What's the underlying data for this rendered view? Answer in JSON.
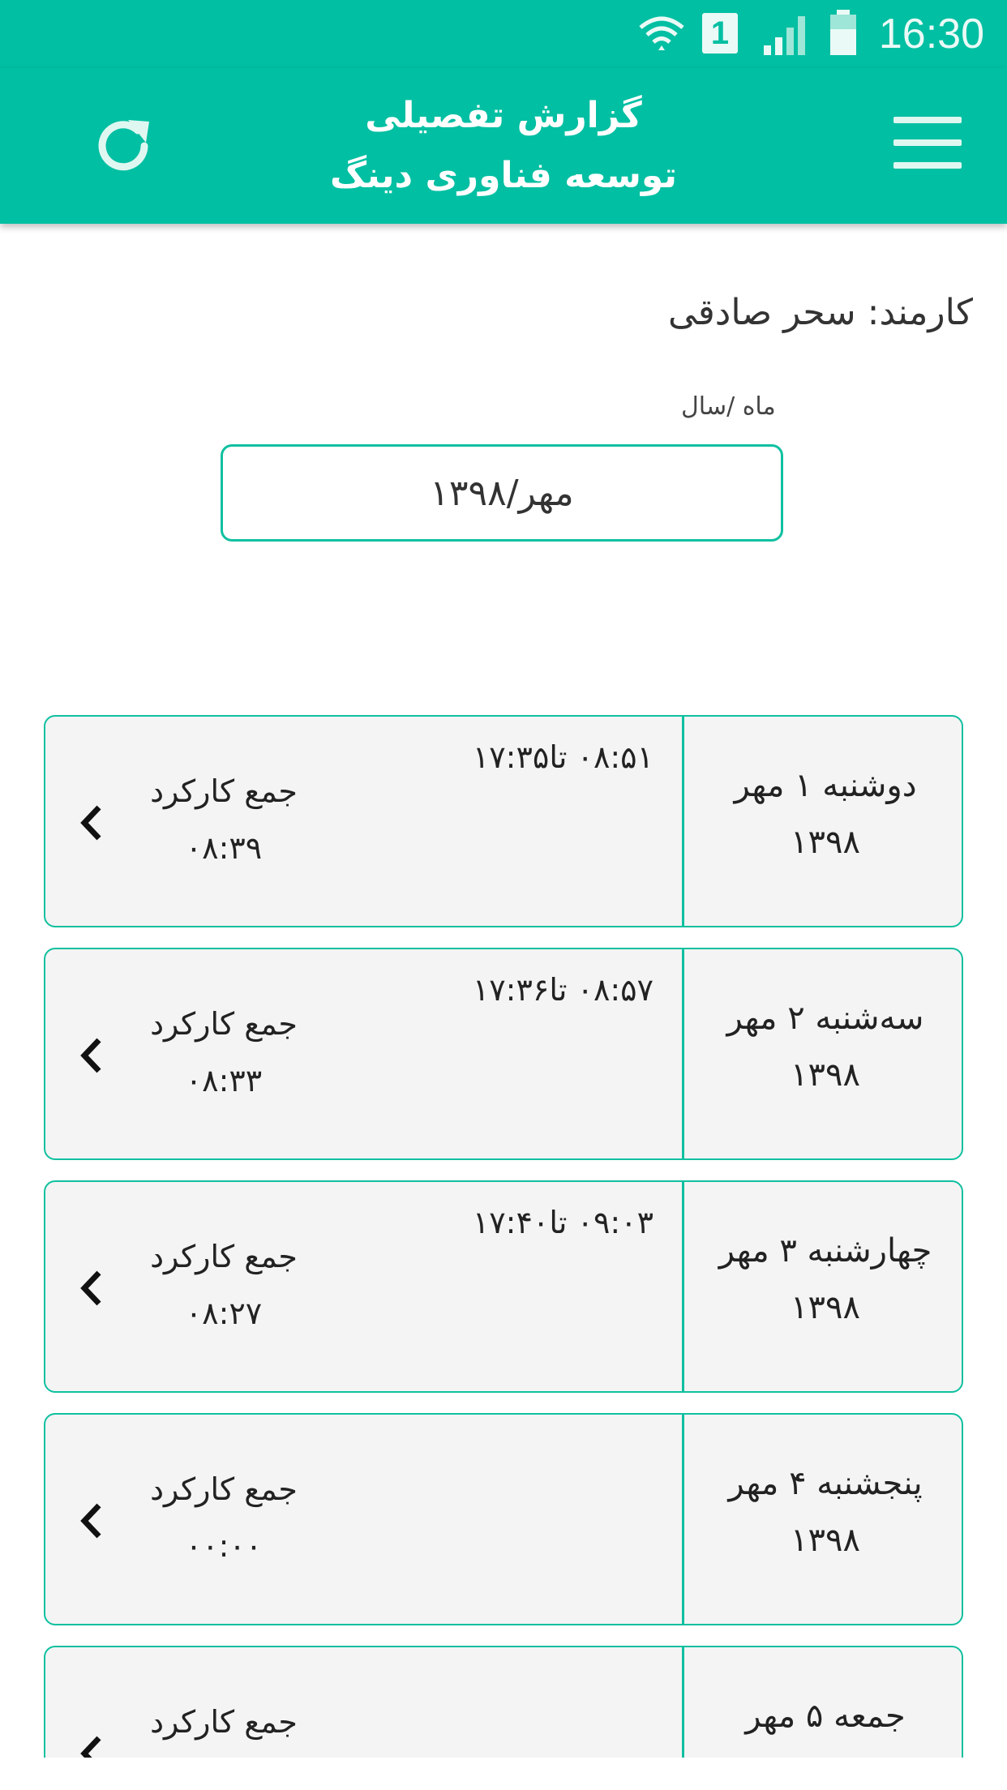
{
  "status_bar": {
    "time": "16:30",
    "sim_label": "1",
    "icons": [
      "wifi-icon",
      "sim-icon",
      "signal-icon",
      "battery-icon"
    ]
  },
  "app_bar": {
    "title_line1": "گزارش تفصیلی",
    "title_line2": "توسعه فناوری دینگ",
    "menu_icon": "hamburger-menu-icon",
    "refresh_icon": "refresh-icon"
  },
  "employee": {
    "label": "کارمند:",
    "name": "سحر صادقی"
  },
  "month_picker": {
    "label": "ماه /سال",
    "value": "مهر/۱۳۹۸"
  },
  "colors": {
    "primary": "#00bfa2",
    "border": "#10c0a0",
    "card_bg": "#f4f4f4"
  },
  "days": [
    {
      "day": "دوشنبه  ۱ مهر",
      "year": "۱۳۹۸",
      "times": "۰۸:۵۱ تا۱۷:۳۵",
      "sum_label": "جمع کارکرد",
      "sum_value": "۰۸:۳۹"
    },
    {
      "day": "سه‌شنبه  ۲ مهر",
      "year": "۱۳۹۸",
      "times": "۰۸:۵۷ تا۱۷:۳۶",
      "sum_label": "جمع کارکرد",
      "sum_value": "۰۸:۳۳"
    },
    {
      "day": "چهارشنبه  ۳ مهر",
      "year": "۱۳۹۸",
      "times": "۰۹:۰۳ تا۱۷:۴۰",
      "sum_label": "جمع کارکرد",
      "sum_value": "۰۸:۲۷"
    },
    {
      "day": "پنجشنبه  ۴ مهر",
      "year": "۱۳۹۸",
      "times": "",
      "sum_label": "جمع کارکرد",
      "sum_value": "۰۰:۰۰"
    },
    {
      "day": "جمعه  ۵ مهر",
      "year": "",
      "times": "",
      "sum_label": "جمع کارکرد",
      "sum_value": ""
    }
  ]
}
